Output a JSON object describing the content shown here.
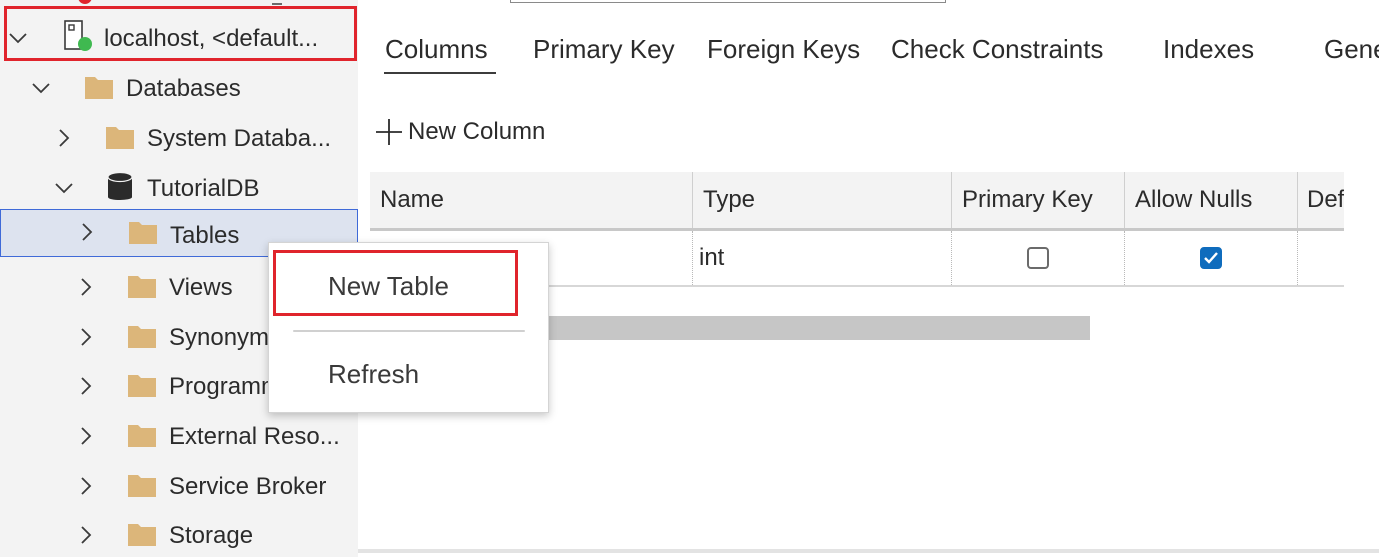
{
  "sidebar": {
    "connection": {
      "label": "localhost, <default..."
    },
    "items": [
      {
        "label": "Databases",
        "icon": "folder-icon"
      },
      {
        "label": "System Databa...",
        "icon": "folder-icon"
      },
      {
        "label": "TutorialDB",
        "icon": "database-icon"
      },
      {
        "label": "Tables",
        "icon": "folder-icon",
        "selected": true
      },
      {
        "label": "Views",
        "icon": "folder-icon"
      },
      {
        "label": "Synonyms",
        "icon": "folder-icon"
      },
      {
        "label": "Programmability",
        "icon": "folder-icon"
      },
      {
        "label": "External Reso...",
        "icon": "folder-icon"
      },
      {
        "label": "Service Broker",
        "icon": "folder-icon"
      },
      {
        "label": "Storage",
        "icon": "folder-icon"
      }
    ]
  },
  "designer": {
    "tabs": [
      {
        "label": "Columns",
        "active": true
      },
      {
        "label": "Primary Key"
      },
      {
        "label": "Foreign Keys"
      },
      {
        "label": "Check Constraints"
      },
      {
        "label": "Indexes"
      },
      {
        "label": "General"
      }
    ],
    "new_column_label": "New Column",
    "columns_header": [
      "Name",
      "Type",
      "Primary Key",
      "Allow Nulls",
      "Default Value"
    ],
    "rows": [
      {
        "name": "",
        "type": "int",
        "primary_key": false,
        "allow_nulls": true
      }
    ]
  },
  "context_menu": {
    "items": [
      {
        "label": "New Table",
        "highlighted": true
      },
      {
        "label": "Refresh"
      }
    ]
  },
  "colors": {
    "accent": "#0f6cbd",
    "highlight_border": "#e0242c",
    "folder": "#dcb67a",
    "status_online": "#3fb950",
    "selection_bg": "#dde3ef"
  }
}
